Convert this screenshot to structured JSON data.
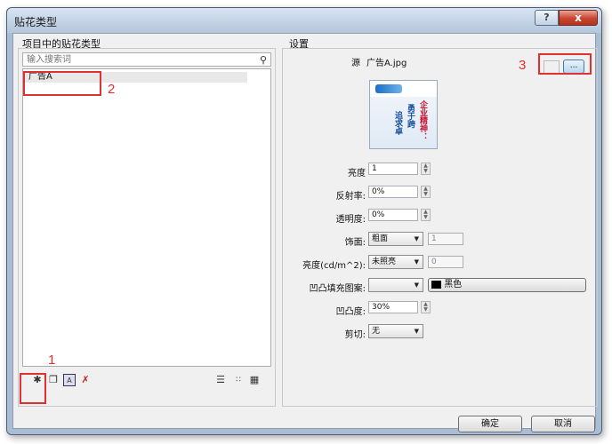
{
  "window": {
    "title": "贴花类型",
    "help_label": "?",
    "close_label": "x"
  },
  "left": {
    "group_title": "项目中的贴花类型",
    "search_placeholder": "输入搜索词",
    "items": [
      "广告A"
    ]
  },
  "right": {
    "group_title": "设置",
    "source_label": "源",
    "source_value": "广告A.jpg",
    "browse_label": "...",
    "preview_text": {
      "col1": "企业精神：",
      "col2": "勇于跨",
      "col3": "追求卓"
    },
    "brightness_label": "亮度",
    "brightness_value": "1",
    "reflectivity_label": "反射率:",
    "reflectivity_value": "0%",
    "transparency_label": "透明度:",
    "transparency_value": "0%",
    "finish_label": "饰面:",
    "finish_value": "粗面",
    "finish_num": "1",
    "luminance_label": "亮度(cd/m^2):",
    "luminance_value": "未照亮",
    "luminance_num": "0",
    "bump_pattern_label": "凹凸填充图案:",
    "bump_pattern_value": "",
    "bump_color_value": "黑色",
    "bump_amount_label": "凹凸度:",
    "bump_amount_value": "30%",
    "cutout_label": "剪切:",
    "cutout_value": "无"
  },
  "buttons": {
    "ok": "确定",
    "cancel": "取消"
  },
  "annotations": {
    "n1": "1",
    "n2": "2",
    "n3": "3"
  },
  "colors": {
    "annotation": "#e03030"
  }
}
